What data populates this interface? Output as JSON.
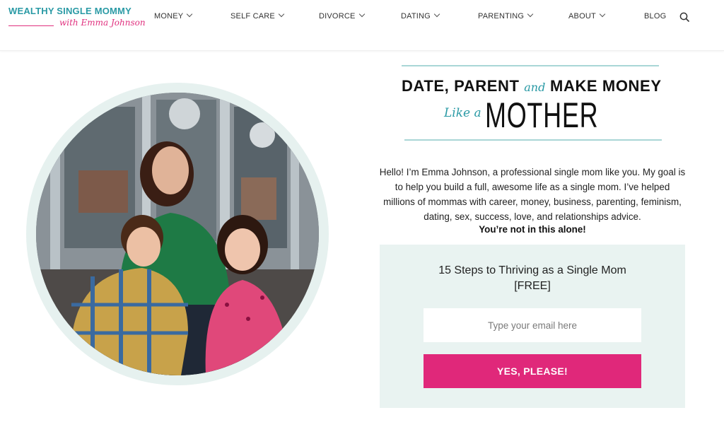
{
  "brand": {
    "name": "WEALTHY SINGLE MOMMY",
    "tagline": "with Emma Johnson"
  },
  "nav": {
    "items": [
      {
        "label": "MONEY",
        "has_dropdown": true
      },
      {
        "label": "SELF CARE",
        "has_dropdown": true
      },
      {
        "label": "DIVORCE",
        "has_dropdown": true
      },
      {
        "label": "DATING",
        "has_dropdown": true
      },
      {
        "label": "PARENTING",
        "has_dropdown": true
      },
      {
        "label": "ABOUT",
        "has_dropdown": true
      },
      {
        "label": "BLOG",
        "has_dropdown": false
      }
    ],
    "search_icon": "search-icon"
  },
  "hero": {
    "headline_part1": "DATE, PARENT",
    "headline_and": "and",
    "headline_part2": "MAKE MONEY",
    "headline_like_a": "Like a",
    "headline_mother": "MOTHER",
    "intro": "Hello! I’m Emma Johnson, a professional single mom like you. My goal is to help you build a full, awesome life as a single mom. I’ve helped millions of mommas with career, money, business, parenting, feminism, dating, sex, success, love, and relationships advice.",
    "intro_bold": "You’re not in this alone!"
  },
  "optin": {
    "title_line1": "15 Steps to Thriving as a Single Mom",
    "title_line2": "[FREE]",
    "email_placeholder": "Type your email here",
    "email_value": "",
    "button_label": "YES, PLEASE!"
  },
  "colors": {
    "teal": "#2a9aa5",
    "pink": "#e0287a",
    "panel": "#e9f3f1",
    "ring": "#e6f1ef"
  }
}
